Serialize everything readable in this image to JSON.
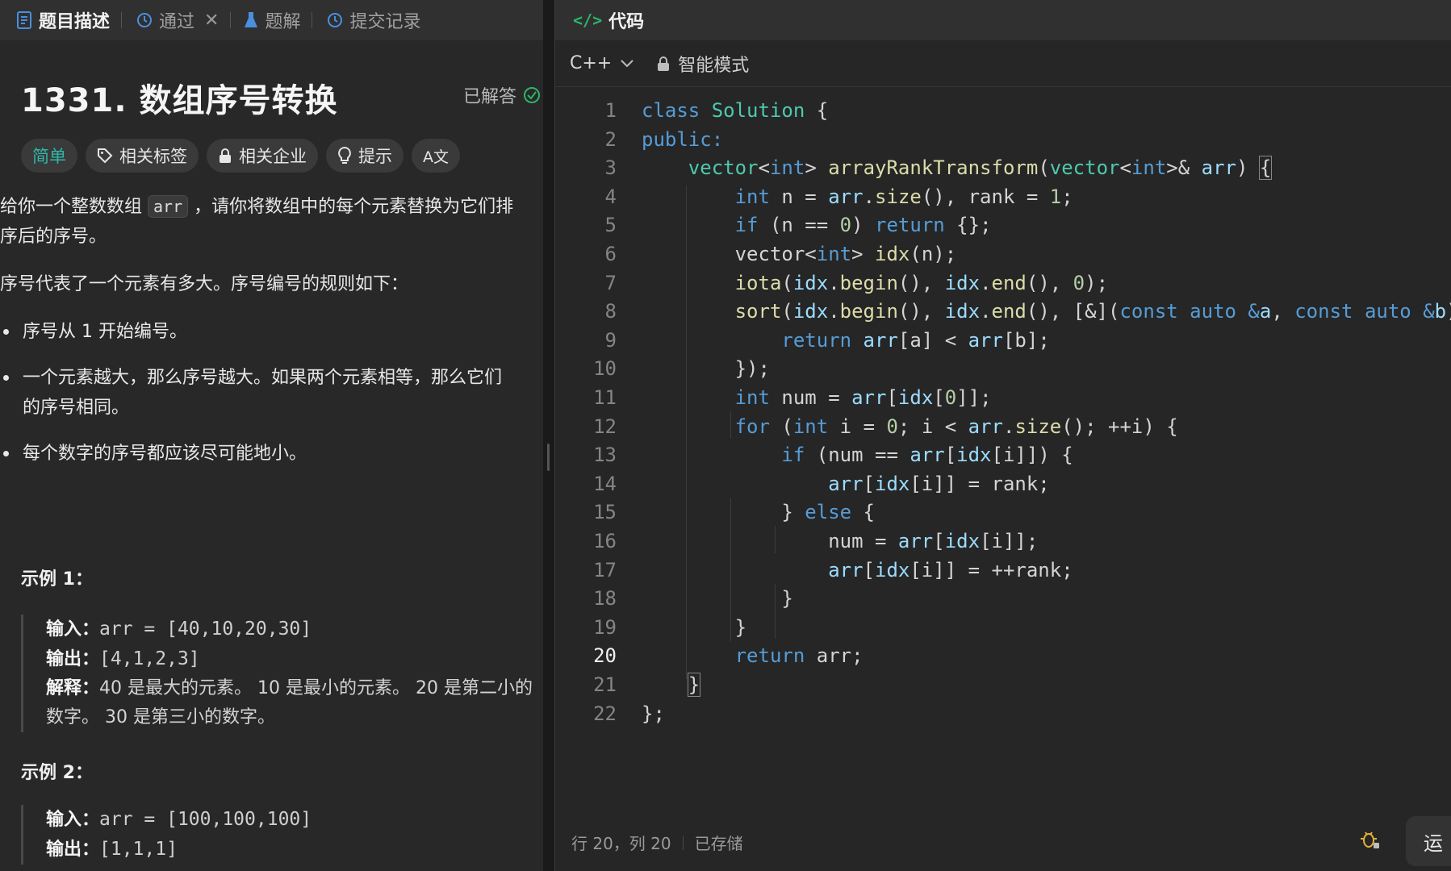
{
  "left_tabs": [
    {
      "label": "题目描述",
      "icon": "document-icon",
      "active": true
    },
    {
      "label": "通过",
      "icon": "history-icon",
      "closable": true
    },
    {
      "label": "题解",
      "icon": "flask-icon"
    },
    {
      "label": "提交记录",
      "icon": "history-icon"
    }
  ],
  "problem": {
    "title": "1331. 数组序号转换",
    "status": "已解答",
    "tags": {
      "difficulty": "简单",
      "topics": "相关标签",
      "companies": "相关企业",
      "hint": "提示",
      "translate": "A文"
    },
    "desc_p1_a": "给你一个整数数组 ",
    "desc_p1_code": "arr",
    "desc_p1_b": " ，请你将数组中的每个元素替换为它们排序后的序号。",
    "desc_p2": "序号代表了一个元素有多大。序号编号的规则如下：",
    "rules": [
      "序号从 1 开始编号。",
      "一个元素越大，那么序号越大。如果两个元素相等，那么它们的序号相同。",
      "每个数字的序号都应该尽可能地小。"
    ],
    "example1": {
      "title": "示例 1：",
      "input_label": "输入：",
      "input": "arr = [40,10,20,30]",
      "output_label": "输出：",
      "output": "[4,1,2,3]",
      "explain_label": "解释：",
      "explain": "40 是最大的元素。 10 是最小的元素。 20 是第二小的数字。 30 是第三小的数字。"
    },
    "example2": {
      "title": "示例 2：",
      "input_label": "输入：",
      "input": "arr = [100,100,100]",
      "output_label": "输出：",
      "output": "[1,1,1]"
    }
  },
  "code_panel": {
    "title": "代码",
    "language": "C++",
    "mode": "智能模式",
    "current_line": 20,
    "status_position": "行 20，列 20",
    "status_saved": "已存储",
    "run_label": "运"
  },
  "code_lines": [
    "1",
    "2",
    "3",
    "4",
    "5",
    "6",
    "7",
    "8",
    "9",
    "10",
    "11",
    "12",
    "13",
    "14",
    "15",
    "16",
    "17",
    "18",
    "19",
    "20",
    "21",
    "22"
  ],
  "colors": {
    "keyword": "#569cd6",
    "type": "#4ec9b0",
    "function": "#dcdcaa",
    "variable": "#9cdcfe",
    "number": "#b5cea8",
    "easy": "#2fb8a8",
    "accepted": "#2cb56a"
  }
}
